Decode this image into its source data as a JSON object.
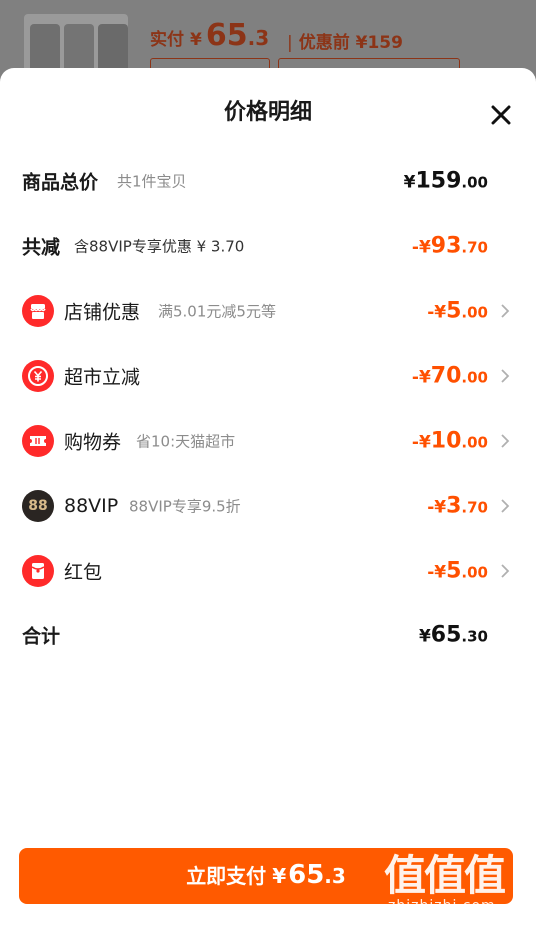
{
  "background": {
    "paid_label": "实付",
    "paid_currency": "¥",
    "paid_int": "65",
    "paid_dec": ".3",
    "before_sep": "|",
    "before_label": "优惠前 ¥159"
  },
  "sheet": {
    "title": "价格明细"
  },
  "total": {
    "label": "商品总价",
    "sub": "共1件宝贝",
    "currency": "¥",
    "int": "159",
    "dec": ".00"
  },
  "reduce": {
    "label": "共减",
    "sub": "含88VIP专享优惠 ¥ 3.70",
    "sign": "-¥",
    "int": "93",
    "dec": ".70"
  },
  "items": [
    {
      "icon": "store-icon",
      "label": "店铺优惠",
      "sub": "满5.01元减5元等",
      "sign": "-¥",
      "int": "5",
      "dec": ".00"
    },
    {
      "icon": "yen-icon",
      "label": "超市立减",
      "sub": "",
      "sign": "-¥",
      "int": "70",
      "dec": ".00"
    },
    {
      "icon": "coupon-icon",
      "label": "购物券",
      "sub": "省10:天猫超市",
      "sign": "-¥",
      "int": "10",
      "dec": ".00"
    },
    {
      "icon": "vip88-icon",
      "icon_text": "88",
      "label": "88VIP",
      "sub": "88VIP专享9.5折",
      "sign": "-¥",
      "int": "3",
      "dec": ".70"
    },
    {
      "icon": "red-packet-icon",
      "label": "红包",
      "sub": "",
      "sign": "-¥",
      "int": "5",
      "dec": ".00"
    }
  ],
  "sum": {
    "label": "合计",
    "currency": "¥",
    "int": "65",
    "dec": ".30"
  },
  "pay_button": {
    "label": "立即支付",
    "currency": "¥",
    "int": "65",
    "dec": ".3"
  },
  "watermark": {
    "logo": "值值值",
    "url": "zhizhizhi.com"
  },
  "colors": {
    "accent": "#ff5000",
    "button": "#ff5a00",
    "icon_red": "#ff2a2a"
  }
}
